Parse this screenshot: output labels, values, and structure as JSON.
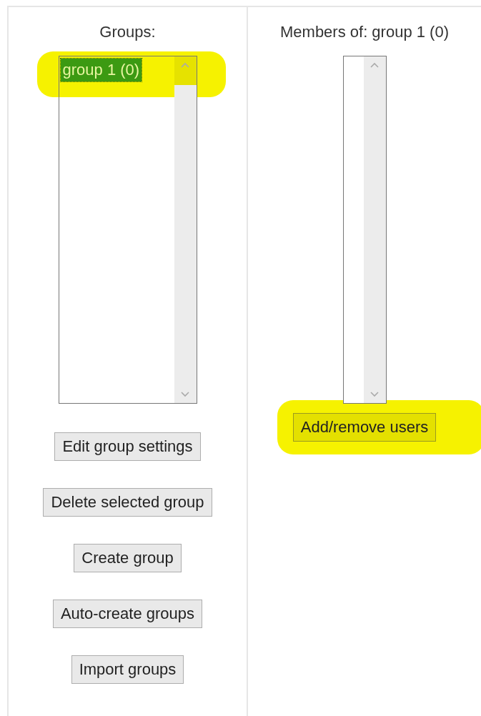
{
  "groups_panel": {
    "heading": "Groups:",
    "list": {
      "highlighted": true,
      "items": [
        {
          "label": "group 1 (0)",
          "selected": true
        }
      ]
    },
    "buttons": [
      {
        "label": "Edit group settings",
        "highlighted": false
      },
      {
        "label": "Delete selected group",
        "highlighted": false
      },
      {
        "label": "Create group",
        "highlighted": false
      },
      {
        "label": "Auto-create groups",
        "highlighted": false
      },
      {
        "label": "Import groups",
        "highlighted": false
      }
    ]
  },
  "members_panel": {
    "heading": "Members of: group 1 (0)",
    "list": {
      "highlighted": false
    },
    "buttons": [
      {
        "label": "Add/remove users",
        "highlighted": true
      }
    ]
  }
}
